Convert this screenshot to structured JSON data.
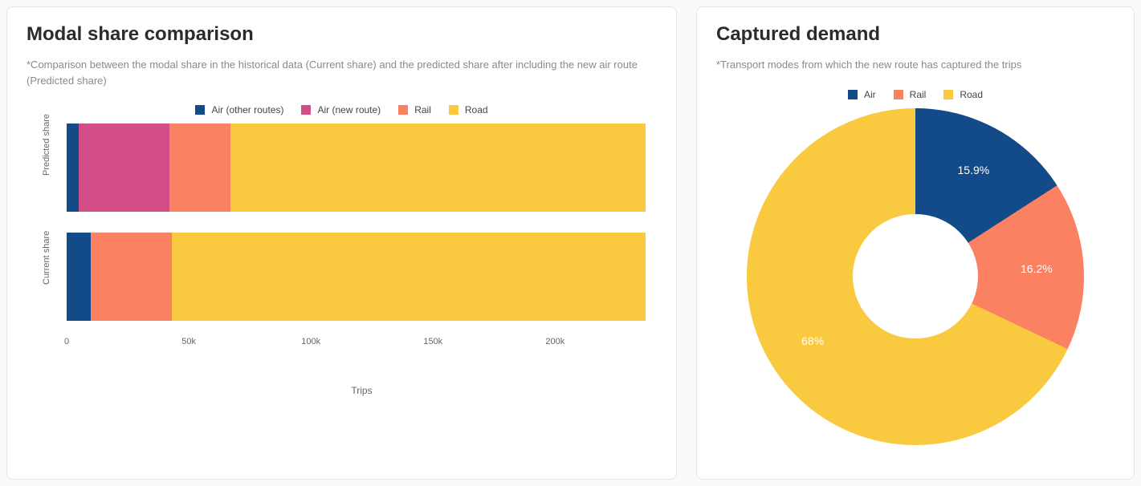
{
  "left": {
    "title": "Modal share comparison",
    "subtitle": "*Comparison between the modal share in the historical data (Current share) and the predicted share after including the new air route (Predicted share)",
    "legend": [
      {
        "label": "Air (other routes)",
        "color": "#134b88"
      },
      {
        "label": "Air (new route)",
        "color": "#d34e87"
      },
      {
        "label": "Rail",
        "color": "#fa8263"
      },
      {
        "label": "Road",
        "color": "#f9c940"
      }
    ],
    "xAxisLabel": "Trips",
    "ticks": [
      "0",
      "50k",
      "100k",
      "150k",
      "200k"
    ]
  },
  "right": {
    "title": "Captured demand",
    "subtitle": "*Transport modes from which the new route has captured the trips",
    "legend": [
      {
        "label": "Air",
        "color": "#134b88"
      },
      {
        "label": "Rail",
        "color": "#fa8263"
      },
      {
        "label": "Road",
        "color": "#f9c940"
      }
    ],
    "sliceLabels": {
      "air": "15.9%",
      "rail": "16.2%",
      "road": "68%"
    }
  },
  "chart_data": [
    {
      "type": "bar",
      "orientation": "horizontal-stacked",
      "title": "Modal share comparison",
      "xlabel": "Trips",
      "ylabel": "",
      "xlim": [
        0,
        240000
      ],
      "categories": [
        "Predicted share",
        "Current share"
      ],
      "series": [
        {
          "name": "Air (other routes)",
          "values": [
            5000,
            10000
          ]
        },
        {
          "name": "Air (new route)",
          "values": [
            37000,
            0
          ]
        },
        {
          "name": "Rail",
          "values": [
            25000,
            33000
          ]
        },
        {
          "name": "Road",
          "values": [
            170000,
            194000
          ]
        }
      ]
    },
    {
      "type": "pie",
      "subtype": "donut",
      "title": "Captured demand",
      "series": [
        {
          "name": "Air",
          "value": 15.9
        },
        {
          "name": "Rail",
          "value": 16.2
        },
        {
          "name": "Road",
          "value": 68.0
        }
      ]
    }
  ]
}
